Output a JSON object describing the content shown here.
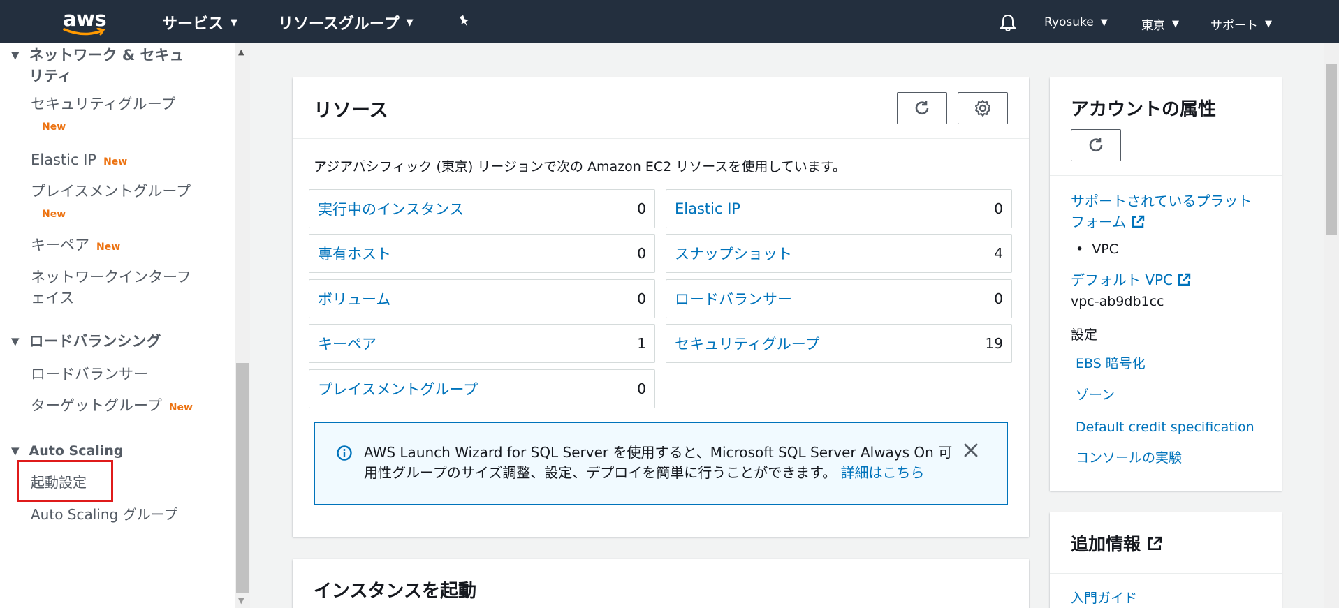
{
  "topbar": {
    "logo_text": "aws",
    "services_label": "サービス",
    "resource_groups_label": "リソースグループ",
    "user_label": "Ryosuke",
    "region_label": "東京",
    "support_label": "サポート"
  },
  "sidebar": {
    "network_section": "ネットワーク & セキュリティ",
    "network_items": {
      "security_groups": "セキュリティグループ",
      "elastic_ip": "Elastic IP",
      "placement_groups": "プレイスメントグループ",
      "key_pairs": "キーペア",
      "network_interfaces": "ネットワークインターフェイス"
    },
    "lb_section": "ロードバランシング",
    "lb_items": {
      "load_balancers": "ロードバランサー",
      "target_groups": "ターゲットグループ"
    },
    "as_section": "Auto Scaling",
    "as_items": {
      "launch_config": "起動設定",
      "as_groups": "Auto Scaling グループ"
    },
    "new_badge": "New"
  },
  "resources": {
    "title": "リソース",
    "description": "アジアパシフィック (東京) リージョンで次の Amazon EC2 リソースを使用しています。",
    "items": [
      {
        "label": "実行中のインスタンス",
        "count": "0"
      },
      {
        "label": "Elastic IP",
        "count": "0"
      },
      {
        "label": "専有ホスト",
        "count": "0"
      },
      {
        "label": "スナップショット",
        "count": "4"
      },
      {
        "label": "ボリューム",
        "count": "0"
      },
      {
        "label": "ロードバランサー",
        "count": "0"
      },
      {
        "label": "キーペア",
        "count": "1"
      },
      {
        "label": "セキュリティグループ",
        "count": "19"
      },
      {
        "label": "プレイスメントグループ",
        "count": "0"
      }
    ],
    "info_text": "AWS Launch Wizard for SQL Server を使用すると、Microsoft SQL Server Always On 可用性グループのサイズ調整、設定、デプロイを簡単に行うことができます。",
    "info_link": "詳細はこちら"
  },
  "launch": {
    "title": "インスタンスを起動"
  },
  "account": {
    "title": "アカウントの属性",
    "supported_platforms_link": "サポートされているプラットフォーム",
    "platform_value": "VPC",
    "default_vpc_link": "デフォルト VPC",
    "default_vpc_value": "vpc-ab9db1cc",
    "settings_label": "設定",
    "ebs_link": "EBS 暗号化",
    "zones_link": "ゾーン",
    "credit_link": "Default credit specification",
    "console_link": "コンソールの実験"
  },
  "additional": {
    "title": "追加情報",
    "getting_started_link": "入門ガイド"
  }
}
